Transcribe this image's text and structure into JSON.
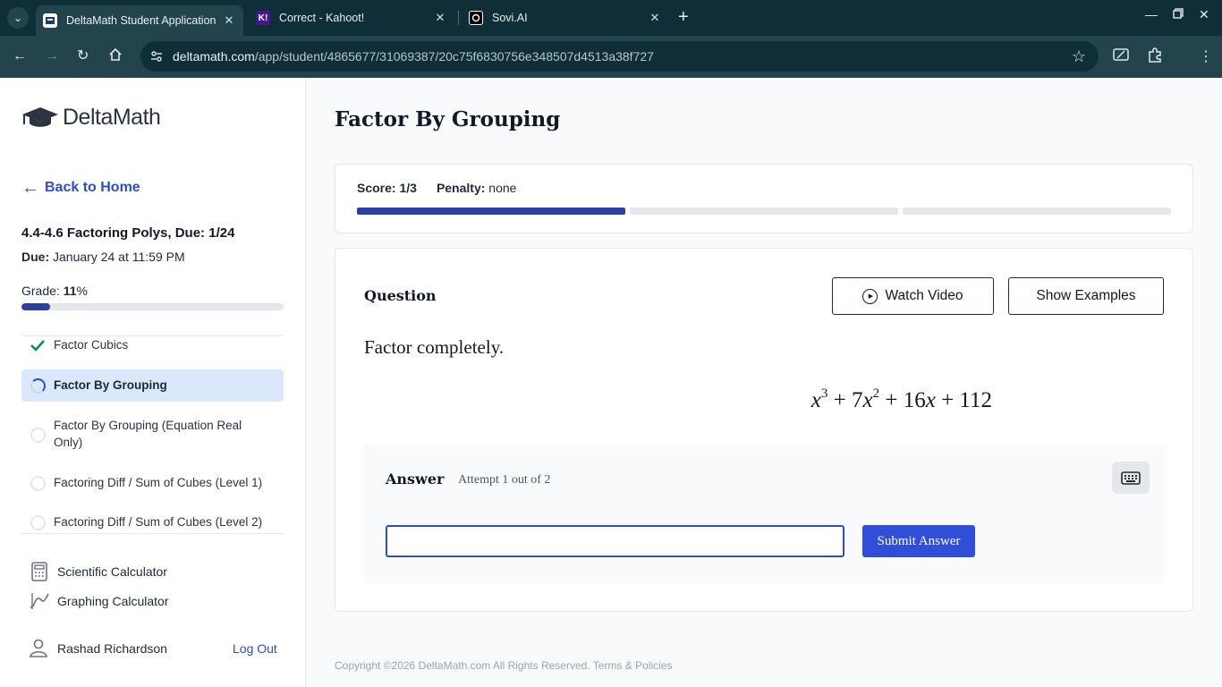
{
  "browser": {
    "tabs": [
      {
        "title": "DeltaMath Student Application",
        "active": true,
        "favicon": "deltamath-favicon"
      },
      {
        "title": "Correct - Kahoot!",
        "active": false,
        "favicon": "kahoot-favicon",
        "favicon_text": "K!"
      },
      {
        "title": "Sovi.AI",
        "active": false,
        "favicon": "sovi-favicon"
      }
    ],
    "url_host": "deltamath.com",
    "url_path": "/app/student/4865677/31069387/20c75f6830756e348507d4513a38f727"
  },
  "sidebar": {
    "logo_text": "DeltaMath",
    "back_label": "Back to Home",
    "assignment_title": "4.4-4.6 Factoring Polys, Due: 1/24",
    "due_label": "Due:",
    "due_value": " January 24 at 11:59 PM",
    "grade_label": "Grade: ",
    "grade_value": "11",
    "grade_suffix": "%",
    "grade_fraction": 0.11,
    "problems": [
      {
        "label": "Factor Cubics",
        "status": "complete"
      },
      {
        "label": "Factor By Grouping",
        "status": "in-progress",
        "active": true
      },
      {
        "label": "Factor By Grouping (Equation Real Only)",
        "status": "not-started"
      },
      {
        "label": "Factoring Diff / Sum of Cubes (Level 1)",
        "status": "not-started"
      },
      {
        "label": "Factoring Diff / Sum of Cubes (Level 2)",
        "status": "not-started"
      }
    ],
    "tools": [
      {
        "label": "Scientific Calculator",
        "icon": "calculator-icon"
      },
      {
        "label": "Graphing Calculator",
        "icon": "graph-icon"
      }
    ],
    "user_name": "Rashad Richardson",
    "logout_label": "Log Out"
  },
  "main": {
    "page_title": "Factor By Grouping",
    "score_label": "Score:",
    "score_value": " 1/3",
    "penalty_label": "Penalty:",
    "penalty_value": " none",
    "progress_segments": [
      true,
      false,
      false
    ],
    "question_label": "Question",
    "watch_video_label": "Watch Video",
    "show_examples_label": "Show Examples",
    "prompt": "Factor completely.",
    "expression": {
      "x": "x",
      "exp3": "3",
      "plus_7": " + 7",
      "exp2": "2",
      "plus_16": " + 16",
      "plus_112": " + 112"
    },
    "answer_label": "Answer",
    "attempt_text": "Attempt 1 out of 2",
    "answer_value": "",
    "submit_label": "Submit Answer",
    "footer_text": "Copyright ©2026 DeltaMath.com All Rights Reserved. ",
    "footer_link": "Terms & Policies"
  }
}
